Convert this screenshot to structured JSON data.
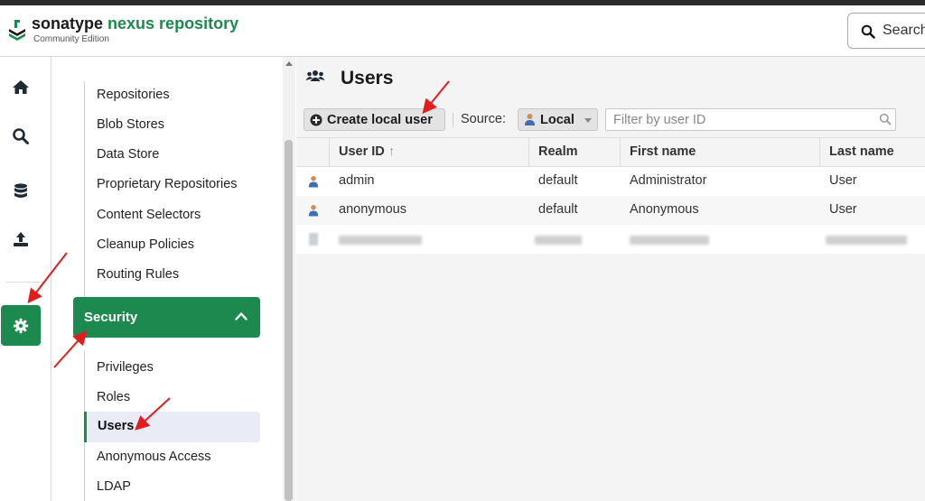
{
  "header": {
    "brand_part1": "sonatype",
    "brand_part2": " nexus repository",
    "edition": "Community Edition",
    "search_label": "Search"
  },
  "colors": {
    "brand_green": "#1c8a4e",
    "active_item_bg": "#e9ecf6"
  },
  "icon_rail": [
    "home-icon",
    "search-icon",
    "database-icon",
    "upload-icon",
    "gear-icon"
  ],
  "nav": {
    "items_top": [
      "Repositories",
      "Blob Stores",
      "Data Store",
      "Proprietary Repositories",
      "Content Selectors",
      "Cleanup Policies",
      "Routing Rules"
    ],
    "section_label": "Security",
    "items_security": [
      "Privileges",
      "Roles",
      "Users",
      "Anonymous Access",
      "LDAP"
    ]
  },
  "main": {
    "title": "Users",
    "create_button": "Create local user",
    "source_label": "Source:",
    "source_value": "Local",
    "filter_placeholder": "Filter by user ID",
    "columns": [
      "User ID",
      "Realm",
      "First name",
      "Last name"
    ],
    "sort_indicator": "↑",
    "rows": [
      {
        "user_id": "admin",
        "realm": "default",
        "first_name": "Administrator",
        "last_name": "User"
      },
      {
        "user_id": "anonymous",
        "realm": "default",
        "first_name": "Anonymous",
        "last_name": "User"
      }
    ]
  }
}
